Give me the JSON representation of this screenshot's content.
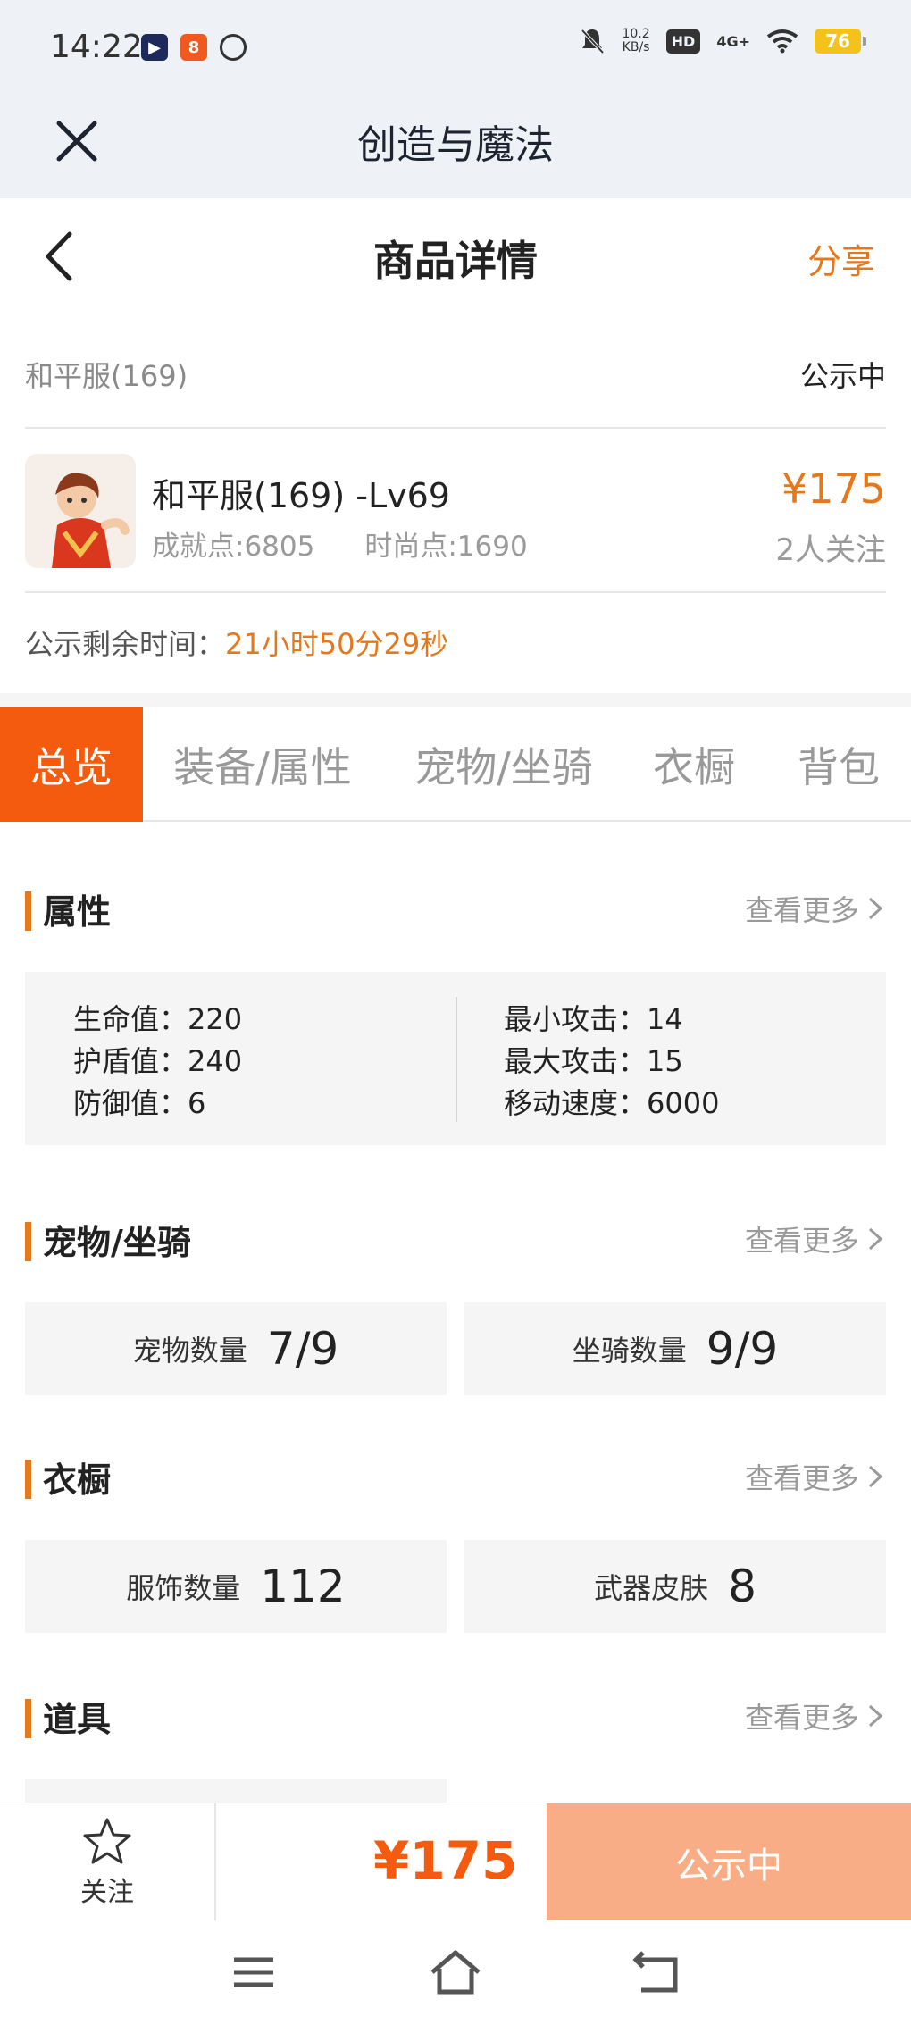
{
  "status_bar": {
    "time": "14:22",
    "net_speed_value": "10.2",
    "net_speed_unit": "KB/s",
    "hd_badge": "HD",
    "signal": "4G+",
    "battery": "76",
    "battery_color": "#f3c21b"
  },
  "mini_app": {
    "title": "创造与魔法",
    "close_icon": "close-icon"
  },
  "header": {
    "title": "商品详情",
    "share_label": "分享",
    "back_icon": "chevron-left-icon"
  },
  "listing": {
    "server": "和平服(169)",
    "status": "公示中",
    "product_name": "和平服(169) -Lv69",
    "achievement": "成就点:6805",
    "fashion": "时尚点:1690",
    "price": "¥175",
    "followers": "2人关注",
    "time_label": "公示剩余时间：",
    "time_remaining": "21小时50分29秒"
  },
  "tabs": [
    {
      "label": "总览",
      "active": true
    },
    {
      "label": "装备/属性",
      "active": false
    },
    {
      "label": "宠物/坐骑",
      "active": false
    },
    {
      "label": "衣橱",
      "active": false
    },
    {
      "label": "背包",
      "active": false
    }
  ],
  "sections": {
    "attributes": {
      "title": "属性",
      "more": "查看更多",
      "left": [
        {
          "label": "生命值：",
          "value": "220"
        },
        {
          "label": "护盾值：",
          "value": "240"
        },
        {
          "label": "防御值：",
          "value": "6"
        }
      ],
      "right": [
        {
          "label": "最小攻击：",
          "value": "14"
        },
        {
          "label": "最大攻击：",
          "value": "15"
        },
        {
          "label": "移动速度：",
          "value": "6000"
        }
      ]
    },
    "pets": {
      "title": "宠物/坐骑",
      "more": "查看更多",
      "stats": [
        {
          "label": "宠物数量",
          "value": "7/9"
        },
        {
          "label": "坐骑数量",
          "value": "9/9"
        }
      ]
    },
    "wardrobe": {
      "title": "衣橱",
      "more": "查看更多",
      "stats": [
        {
          "label": "服饰数量",
          "value": "112"
        },
        {
          "label": "武器皮肤",
          "value": "8"
        }
      ]
    },
    "items": {
      "title": "道具",
      "more": "查看更多"
    }
  },
  "bottom_bar": {
    "follow_label": "关注",
    "price": "¥175",
    "status_button": "公示中",
    "accent_color": "#f45b0f"
  },
  "nav": {
    "menu_icon": "menu-icon",
    "home_icon": "home-icon",
    "back_icon": "back-icon"
  }
}
